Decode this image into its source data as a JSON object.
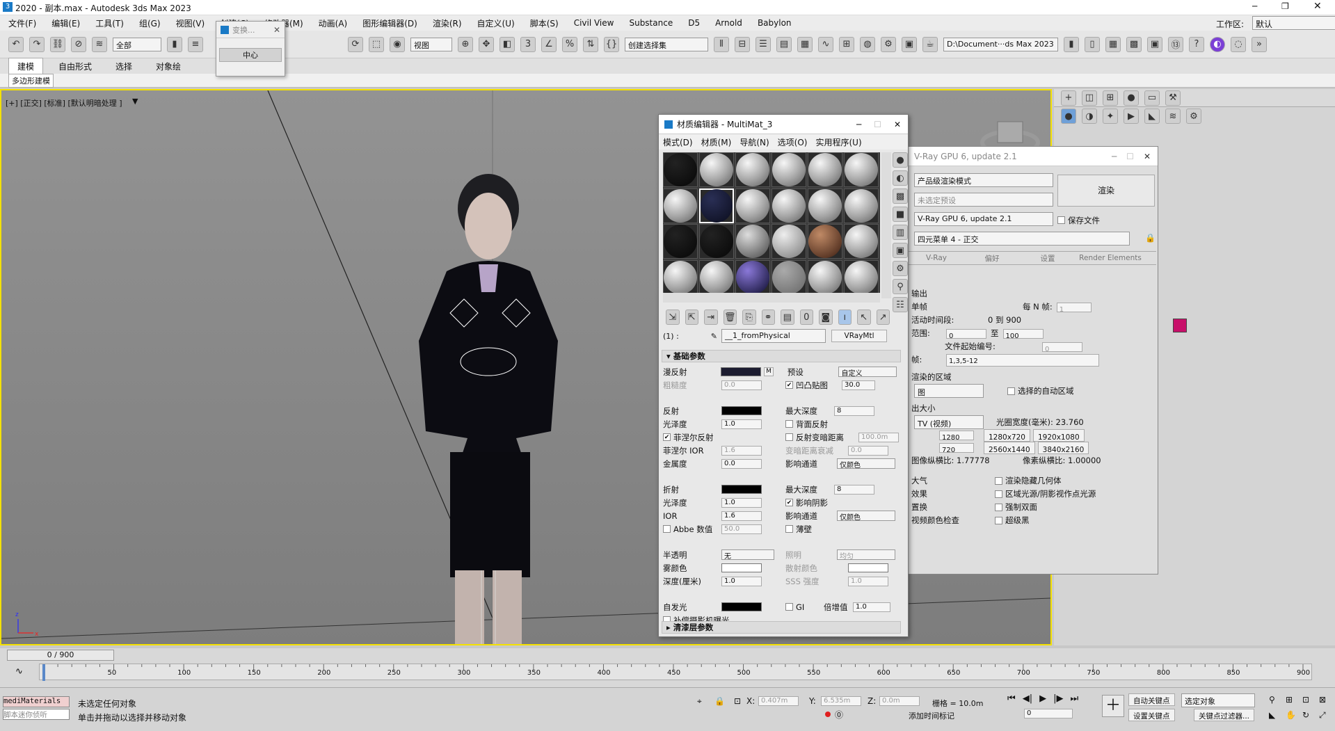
{
  "window": {
    "title": "2020 - 副本.max - Autodesk 3ds Max 2023"
  },
  "menu": [
    "文件(F)",
    "编辑(E)",
    "工具(T)",
    "组(G)",
    "视图(V)",
    "创建(C)",
    "修改器(M)",
    "动画(A)",
    "图形编辑器(D)",
    "渲染(R)",
    "自定义(U)",
    "脚本(S)",
    "Civil View",
    "Substance",
    "D5",
    "Arnold",
    "Babylon"
  ],
  "workspace": {
    "label": "工作区:",
    "value": "默认"
  },
  "toolbar": {
    "filter": "全部",
    "view": "视图",
    "selection_set": "创建选择集",
    "path": "D:\\Document···ds Max 2023"
  },
  "ribbon": {
    "tabs": [
      "建模",
      "自由形式",
      "选择",
      "对象绘"
    ],
    "sub": "多边形建模"
  },
  "transform_dialog": {
    "title": "变换...",
    "button": "中心"
  },
  "viewport": {
    "label": "[+] [正交] [标准] [默认明暗处理 ]"
  },
  "material_editor": {
    "title": "材质编辑器 - MultiMat_3",
    "menu": [
      "模式(D)",
      "材质(M)",
      "导航(N)",
      "选项(O)",
      "实用程序(U)"
    ],
    "slot_name": "__1_fromPhysical",
    "type_button": "VRayMtl",
    "rollout_basic": "基础参数",
    "rollout_coat": "清漆层参数",
    "labels": {
      "diffuse": "漫反射",
      "roughness": "粗糙度",
      "preset": "预设",
      "preset_val": "自定义",
      "bump": "凹凸贴图",
      "bump_val": "30.0",
      "roughness_val": "0.0",
      "reflect": "反射",
      "max_depth": "最大深度",
      "max_depth_val": "8",
      "gloss": "光泽度",
      "gloss_val": "1.0",
      "back_reflect": "背面反射",
      "fresnel": "菲涅尔反射",
      "dim_dist": "反射变暗距离",
      "dim_val": "100.0m",
      "fresnel_ior": "菲涅尔 IOR",
      "fresnel_ior_val": "1.6",
      "dim_falloff": "变暗距离衰减",
      "dim_falloff_val": "0.0",
      "metal": "金属度",
      "metal_val": "0.0",
      "affect_ch": "影响通道",
      "color_only": "仅颜色",
      "refract": "折射",
      "r_max_depth_val": "8",
      "r_gloss_val": "1.0",
      "affect_shadow": "影响阴影",
      "ior": "IOR",
      "ior_val": "1.6",
      "abbe": "Abbe 数值",
      "abbe_val": "50.0",
      "thin": "薄壁",
      "translucent": "半透明",
      "translucent_val": "无",
      "lighting": "照明",
      "lighting_val": "均匀",
      "fog": "雾颜色",
      "scatter": "散射颜色",
      "depth": "深度(厘米)",
      "depth_val": "1.0",
      "sss": "SSS 强度",
      "sss_val": "1.0",
      "selfillum": "自发光",
      "gi": "GI",
      "multiplier": "倍增值",
      "mult_val": "1.0",
      "comp_exposure": "补偿摄影机曝光",
      "slot_index": "(1) :"
    }
  },
  "render_setup": {
    "title": "V-Ray GPU 6, update 2.1",
    "mode": "产品级渲染模式",
    "preset": "未选定预设",
    "renderer": "V-Ray GPU 6, update 2.1",
    "view": "四元菜单 4 - 正交",
    "render_btn": "渲染",
    "save_file": "保存文件",
    "tabs": [
      "V-Ray",
      "偏好",
      "设置",
      "Render Elements"
    ],
    "output": "输出",
    "single": "单帧",
    "every_n": "每 N 帧:",
    "every_n_val": "1",
    "active_seg": "活动时间段:",
    "active_val": "0 到 900",
    "range": "范围:",
    "range_from": "0",
    "to": "至",
    "range_to": "100",
    "file_start": "文件起始编号:",
    "file_start_val": "0",
    "frames": "帧:",
    "frames_val": "1,3,5-12",
    "area": "渲染的区域",
    "area_val": "图",
    "auto_region": "选择的自动区域",
    "size": "出大小",
    "size_val": "TV (视频)",
    "aperture": "光圈宽度(毫米): 23.760",
    "w_val": "1280",
    "h_val": "720",
    "res": [
      "1280x720",
      "1920x1080",
      "2560x1440",
      "3840x2160"
    ],
    "aspect": "图像纵横比: 1.77778",
    "pixel_aspect": "像素纵横比: 1.00000",
    "opts": [
      "大气",
      "渲染隐藏几何体",
      "效果",
      "区域光源/阴影视作点光源",
      "置换",
      "强制双面",
      "视频颜色检查",
      "超级黑"
    ]
  },
  "timeline": {
    "frame": "0 / 900",
    "ticks": [
      "50",
      "100",
      "150",
      "200",
      "250",
      "300",
      "350",
      "400",
      "450",
      "500",
      "550",
      "600",
      "650",
      "700",
      "750",
      "800",
      "850",
      "900"
    ]
  },
  "status": {
    "script": "mediMaterials",
    "script_hint": "脚本迷你侦听",
    "msg1": "未选定任何对象",
    "msg2": "单击并拖动以选择并移动对象",
    "x": "0.407m",
    "y": "6.535m",
    "z": "0.0m",
    "grid": "栅格 = 10.0m",
    "auto_key": "自动关键点",
    "set_key": "设置关键点",
    "sel_obj": "选定对象",
    "key_filter": "关键点过滤器...",
    "add_tag": "添加时间标记",
    "frame_val": "0"
  }
}
